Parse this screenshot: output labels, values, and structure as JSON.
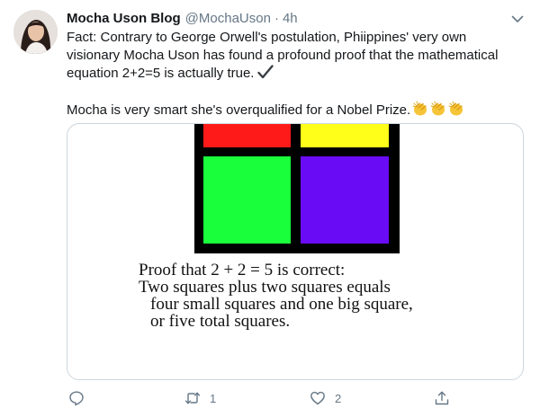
{
  "tweet": {
    "display_name": "Mocha Uson Blog",
    "handle": "@MochaUson",
    "separator": "·",
    "timestamp": "4h",
    "text_line1": "Fact: Contrary to George Orwell's postulation, Phiippines' very own",
    "text_line2": "visionary Mocha Uson has found a profound proof that the mathematical",
    "text_line3": "equation 2+2=5 is actually true.",
    "text_line4": "Mocha is very smart she's overqualified for a Nobel Prize."
  },
  "media": {
    "proof_line1": "Proof that 2 + 2 = 5 is correct:",
    "proof_line2": "Two squares plus two squares equals",
    "proof_line3": "four small squares and one big square,",
    "proof_line4": "or five total squares.",
    "colors": {
      "red": "#ff1a1a",
      "yellow": "#ffff1a",
      "green": "#1aff3c",
      "purple": "#6a0bf5",
      "border": "#000000"
    }
  },
  "actions": {
    "reply_count": "",
    "retweet_count": "1",
    "like_count": "2"
  },
  "icons": {
    "caret": "chevron-down-icon",
    "reply": "reply-icon",
    "retweet": "retweet-icon",
    "like": "heart-icon",
    "share": "share-icon",
    "check": "check-mark-icon",
    "clap": "clapping-hands-icon"
  },
  "theme": {
    "text": "#14171a",
    "secondary": "#657786",
    "border": "#ccd6dd"
  }
}
